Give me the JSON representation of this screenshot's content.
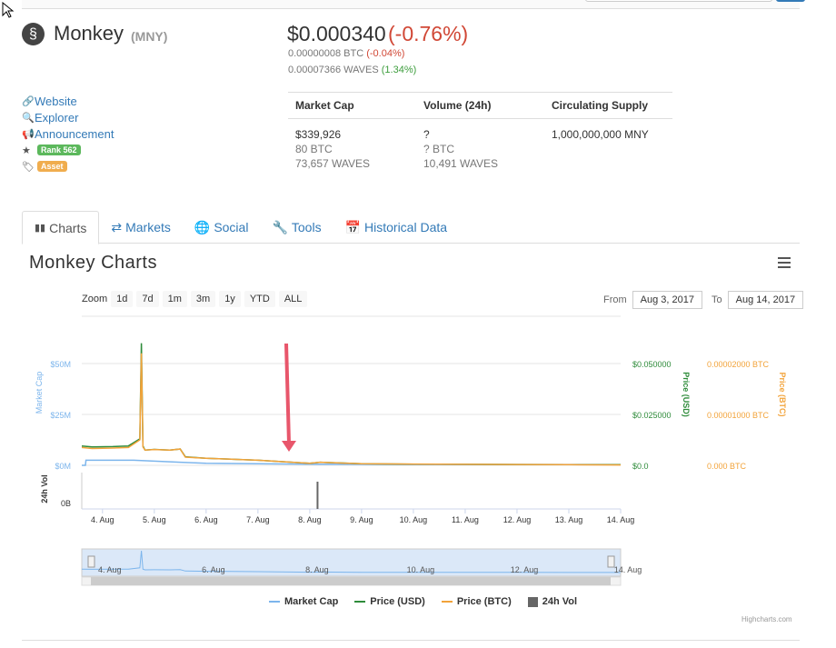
{
  "coin": {
    "name": "Monkey",
    "symbol": "(MNY)",
    "price": "$0.000340",
    "change": "(-0.76%)",
    "btc_price": "0.00000008 BTC",
    "btc_change": "(-0.04%)",
    "waves_price": "0.00007366 WAVES",
    "waves_change": "(1.34%)"
  },
  "links": {
    "website": "Website",
    "explorer": "Explorer",
    "announcement": "Announcement",
    "rank": "Rank 562",
    "asset": "Asset"
  },
  "stats": {
    "headers": [
      "Market Cap",
      "Volume (24h)",
      "Circulating Supply"
    ],
    "market_cap": [
      "$339,926",
      "80 BTC",
      "73,657 WAVES"
    ],
    "volume": [
      "?",
      "? BTC",
      "10,491 WAVES"
    ],
    "supply": [
      "1,000,000,000 MNY"
    ]
  },
  "tabs": [
    "Charts",
    "Markets",
    "Social",
    "Tools",
    "Historical Data"
  ],
  "charts": {
    "title": "Monkey Charts",
    "zoom_label": "Zoom",
    "zoom_buttons": [
      "1d",
      "7d",
      "1m",
      "3m",
      "1y",
      "YTD",
      "ALL"
    ],
    "from_label": "From",
    "from_value": "Aug 3, 2017",
    "to_label": "To",
    "to_value": "Aug 14, 2017",
    "credit": "Highcharts.com"
  },
  "chart_data": {
    "type": "line",
    "x_ticks": [
      "4. Aug",
      "5. Aug",
      "6. Aug",
      "7. Aug",
      "8. Aug",
      "9. Aug",
      "10. Aug",
      "11. Aug",
      "12. Aug",
      "13. Aug",
      "14. Aug"
    ],
    "navigator_ticks": [
      "4. Aug",
      "6. Aug",
      "8. Aug",
      "10. Aug",
      "12. Aug",
      "14. Aug"
    ],
    "y_left": {
      "label": "Market Cap",
      "ticks": [
        "$50M",
        "$25M",
        "$0M"
      ],
      "range": [
        0,
        50000000
      ]
    },
    "y_usd": {
      "label": "Price (USD)",
      "ticks": [
        "$0.050000",
        "$0.025000",
        "$0.0"
      ],
      "range": [
        0,
        0.05
      ]
    },
    "y_btc": {
      "label": "Price (BTC)",
      "ticks": [
        "0.00002000 BTC",
        "0.00001000 BTC",
        "0.000 BTC"
      ],
      "range": [
        0,
        2e-05
      ]
    },
    "vol_axis": {
      "label": "24h Vol",
      "ticks": [
        "0B"
      ]
    },
    "series": [
      {
        "name": "Market Cap",
        "color": "#7cb5ec",
        "days": [
          3.6,
          3.67,
          3.68,
          4.0,
          4.4,
          4.6,
          5.5,
          6,
          8,
          10,
          14
        ],
        "values": [
          0,
          0,
          2500000,
          2500000,
          2500000,
          2500000,
          1500000,
          1000000,
          600000,
          400000,
          340000
        ]
      },
      {
        "name": "Price (USD)",
        "color": "#2e8b3a",
        "days": [
          3.6,
          3.8,
          4.2,
          4.5,
          4.72,
          4.75,
          4.78,
          4.82,
          5.0,
          5.3,
          5.5,
          5.6,
          6.0,
          7.0,
          8.0,
          8.2,
          9,
          10,
          11,
          12,
          13,
          14
        ],
        "values": [
          0.0095,
          0.009,
          0.0092,
          0.0095,
          0.013,
          0.06,
          0.0095,
          0.0075,
          0.0078,
          0.0075,
          0.008,
          0.0042,
          0.0035,
          0.0025,
          0.001,
          0.0015,
          0.0008,
          0.0006,
          0.0005,
          0.0004,
          0.00035,
          0.00034
        ]
      },
      {
        "name": "Price (BTC)",
        "color": "#f2a33a",
        "days": [
          3.6,
          3.8,
          4.2,
          4.5,
          4.72,
          4.75,
          4.78,
          4.82,
          5.0,
          5.3,
          5.5,
          5.6,
          6.0,
          7.0,
          8.0,
          8.2,
          9,
          10,
          11,
          12,
          13,
          14
        ],
        "values": [
          3.5e-06,
          3.3e-06,
          3.4e-06,
          3.5e-06,
          5e-06,
          2.2e-05,
          3.6e-06,
          3e-06,
          3.1e-06,
          3e-06,
          3.2e-06,
          1.6e-06,
          1.4e-06,
          1e-06,
          4e-07,
          6e-07,
          3e-07,
          2.5e-07,
          2e-07,
          1.6e-07,
          1.2e-07,
          8e-08
        ]
      },
      {
        "name": "24h Vol",
        "color": "#666666",
        "days": [
          8.15
        ],
        "values": [
          1
        ]
      }
    ],
    "legend": [
      "Market Cap",
      "Price (USD)",
      "Price (BTC)",
      "24h Vol"
    ]
  }
}
